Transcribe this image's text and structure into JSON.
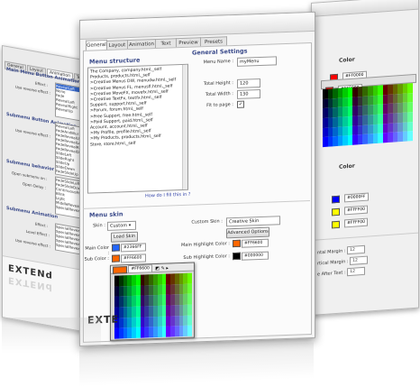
{
  "right_window": {
    "color_heading": "Color",
    "hex_top": "#FF0000",
    "hex_mid": "#FF0000",
    "colors2_heading": "Color",
    "hex_values": [
      "#0000FF",
      "#FFFF00",
      "#FFFF00"
    ],
    "margin_rows": [
      {
        "label": "ntal Margin :",
        "value": "12"
      },
      {
        "label": "rtical Margin :",
        "value": "12"
      },
      {
        "label": "e After Text :",
        "value": "12"
      }
    ],
    "palette_colors": [
      "#000000",
      "#003300",
      "#006600",
      "#009900",
      "#00cc00",
      "#00ff00",
      "#330000",
      "#333300",
      "#336600",
      "#339900",
      "#33cc00",
      "#33ff00",
      "#660000",
      "#663300",
      "#666600",
      "#669900",
      "#66cc00",
      "#66ff00",
      "#000033",
      "#003333",
      "#006633",
      "#009933",
      "#00cc33",
      "#00ff33",
      "#330033",
      "#333333",
      "#336633",
      "#339933",
      "#33cc33",
      "#33ff33",
      "#660033",
      "#663333",
      "#666633",
      "#669933",
      "#66cc33",
      "#66ff33",
      "#000066",
      "#003366",
      "#006666",
      "#009966",
      "#00cc66",
      "#00ff66",
      "#330066",
      "#333366",
      "#336666",
      "#339966",
      "#33cc66",
      "#33ff66",
      "#660066",
      "#663366",
      "#666666",
      "#669966",
      "#66cc66",
      "#66ff66",
      "#000099",
      "#003399",
      "#006699",
      "#009999",
      "#00cc99",
      "#00ff99",
      "#330099",
      "#333399",
      "#336699",
      "#339999",
      "#33cc99",
      "#33ff99",
      "#660099",
      "#663399",
      "#666699",
      "#669999",
      "#66cc99",
      "#66ff99",
      "#0000cc",
      "#0033cc",
      "#0066cc",
      "#0099cc",
      "#00cccc",
      "#00ffcc",
      "#3300cc",
      "#3333cc",
      "#3366cc",
      "#3399cc",
      "#33cccc",
      "#33ffcc",
      "#6600cc",
      "#6633cc",
      "#6666cc",
      "#6699cc",
      "#66cccc",
      "#66ffcc",
      "#0000ff",
      "#0033ff",
      "#0066ff",
      "#0099ff",
      "#00ccff",
      "#00ffff",
      "#3300ff",
      "#3333ff",
      "#3366ff",
      "#3399ff",
      "#33ccff",
      "#33ffff",
      "#6600ff",
      "#6633ff",
      "#6666ff",
      "#6699ff",
      "#66ccff",
      "#66ffff"
    ]
  },
  "left_window": {
    "tabs": [
      "General",
      "Layout",
      "Animation",
      "Text"
    ],
    "section1": "Main Menu Button Animation",
    "effect_label": "Effect :",
    "effect_value": "RevealLeft",
    "reverse_label": "Use reverse effect :",
    "effect_list": [
      "RevealLeft",
      "None",
      "Fade",
      "RevealLeft",
      "RevealRight",
      "RevealUp",
      "RevealDown"
    ],
    "section2": "Submenu Button Animation",
    "effect_list2": [
      "RevealLeft",
      "FadeAndBlur",
      "FadeRevealUp",
      "FadeRevealLeft",
      "FadeRevealRight",
      "FadeRevealDown",
      "SlideLeft",
      "SlideRight",
      "SlideUp",
      "SlideDown",
      "FadeSlideUp"
    ],
    "section3": "Submenu behavior",
    "open_label": "Open submenu on :",
    "open_value": "FadeSlideLeft",
    "delay_label": "Open Delay :",
    "behavior_list": [
      "FadeSlideDown",
      "ContinuousFade",
      "Blink",
      "Light",
      "MiddleReveal",
      "SpecialRevealLeft"
    ],
    "section4": "Submenu Animation",
    "effect2_label": "Effect :",
    "level_label": "Level Effect :",
    "reverse2_label": "Use reverse effect :",
    "anim_list": [
      "SpecialRevealUp",
      "SpecialRevealRight",
      "SpecialRevealDown",
      "SpecialRevealLeft",
      "SpecialRevealUp"
    ],
    "logo_text": "EXTENd"
  },
  "main_window": {
    "tabs": [
      "General",
      "Layout",
      "Animation",
      "Text",
      "Preview",
      "Presets"
    ],
    "menu_structure_title": "Menu structure",
    "menu_items": [
      "The Company, company.html,_self",
      "Products, products.html,_self",
      ">Creative Menus DW, menudw.html,_self",
      ">Creative Menus FL, menusfl.html,_self",
      ">Creative MoveFX, movefx.html,_self",
      ">Creative TextFx, textfx.html,_self",
      "Support, support.html,_self",
      ">Forum, forum.html,_self",
      ">Free Support, free.html,_self",
      ">Paid Support, paid.html,_self",
      "Account, account.html,_self",
      ">My Profile, profile.html,_self",
      ">My Products, products.html,_self",
      "Store, store.html,_self"
    ],
    "help_link": "How do I fill this in ?",
    "general_settings_title": "General Settings",
    "menu_name_label": "Menu Name :",
    "menu_name_value": "myMenu",
    "total_height_label": "Total Height :",
    "total_height_value": "120",
    "total_width_label": "Total Width :",
    "total_width_value": "130",
    "fit_label": "Fit to page :",
    "menu_skin_title": "Menu skin",
    "skin_label": "Skin :",
    "skin_value": "Custom",
    "custom_skin_label": "Custom Skin :",
    "custom_skin_value": "Creative Skin",
    "load_skin_button": "Load Skin",
    "advanced_button": "Advanced Options",
    "main_color_label": "Main Color :",
    "main_color_value": "#2366FF",
    "sub_color_label": "Sub Color :",
    "sub_color_value": "#FF6600",
    "main_highlight_label": "Main Highlight Color :",
    "main_highlight_value": "#FF6600",
    "sub_highlight_label": "Sub Highlight Color :",
    "sub_highlight_value": "#000000",
    "picker_hex": "#FF6600",
    "logo_text": "EXTE",
    "colors": {
      "main_color": "#2366FF",
      "sub_color": "#FF6600",
      "main_highlight": "#FF6600",
      "sub_highlight": "#000000",
      "section_title": "#3a4a8a"
    }
  }
}
